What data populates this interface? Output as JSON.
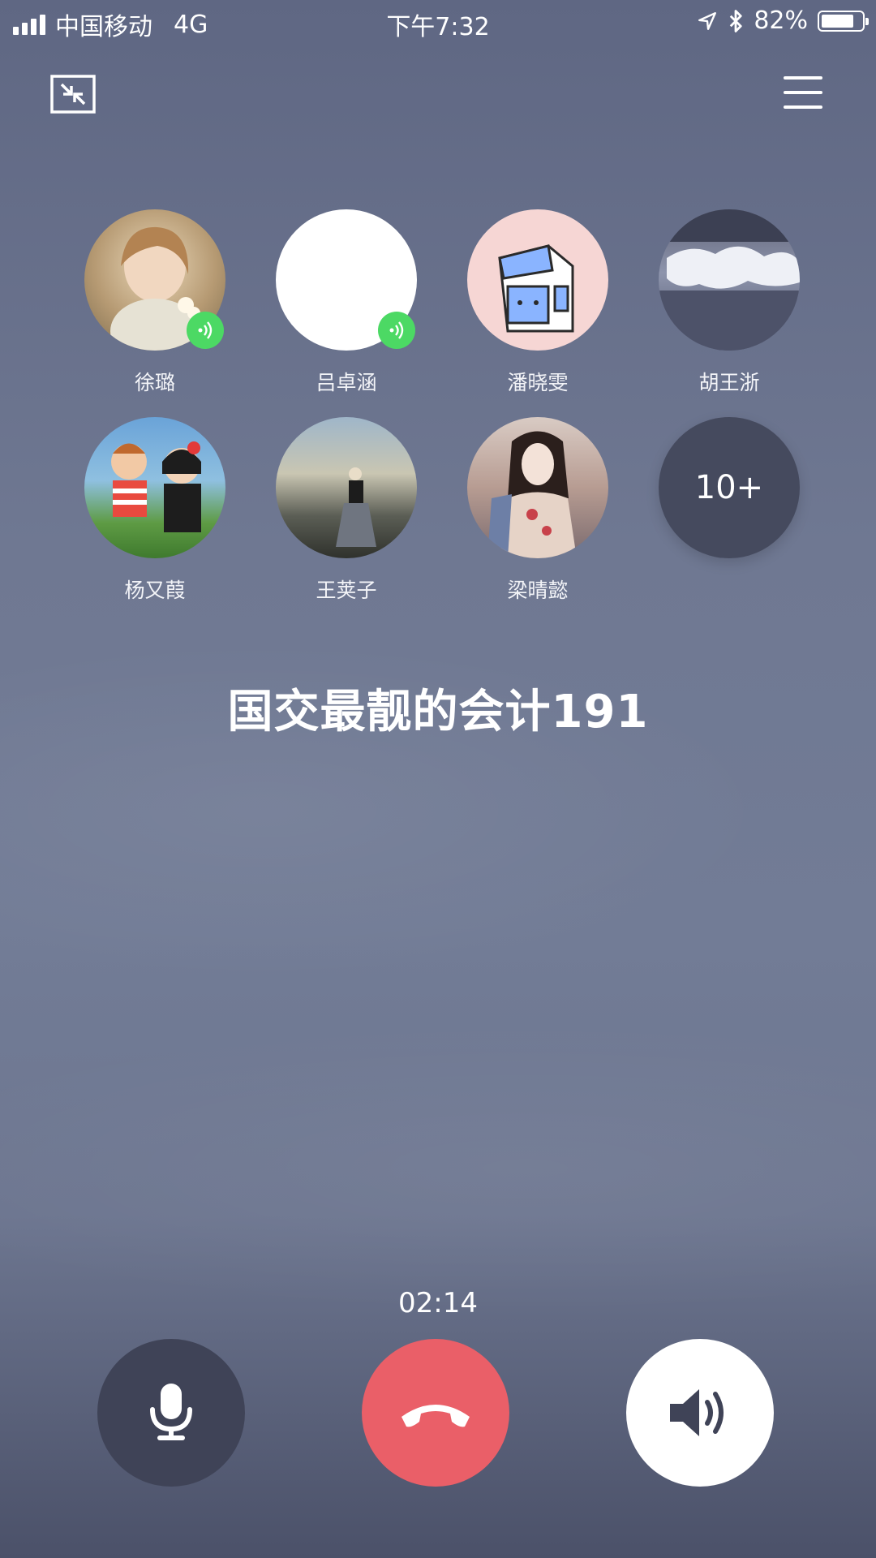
{
  "status_bar": {
    "carrier": "中国移动",
    "network": "4G",
    "time": "下午7:32",
    "battery_percent": "82%",
    "battery_level": 0.82
  },
  "participants": [
    {
      "name": "徐璐",
      "speaking": true,
      "avatar": "art-girl"
    },
    {
      "name": "吕卓涵",
      "speaking": true,
      "avatar": "art-blank"
    },
    {
      "name": "潘晓雯",
      "speaking": false,
      "avatar": "art-milk"
    },
    {
      "name": "胡王浙",
      "speaking": false,
      "avatar": "art-sky"
    },
    {
      "name": "杨又葭",
      "speaking": false,
      "avatar": "art-cartoon"
    },
    {
      "name": "王荚子",
      "speaking": false,
      "avatar": "art-roof"
    },
    {
      "name": "梁晴懿",
      "speaking": false,
      "avatar": "art-woman"
    }
  ],
  "more_participants": "10+",
  "group_title": "国交最靓的会计191",
  "call_timer": "02:14",
  "icons": {
    "minimize": "minimize-icon",
    "menu": "menu-icon",
    "mute": "microphone-icon",
    "hangup": "hangup-icon",
    "speaker": "speaker-icon",
    "speaking": "speaking-icon"
  },
  "colors": {
    "hangup": "#ea5f68",
    "speaking_badge": "#4cd964",
    "mute_button": "#3f4357",
    "speaker_button": "#ffffff"
  }
}
